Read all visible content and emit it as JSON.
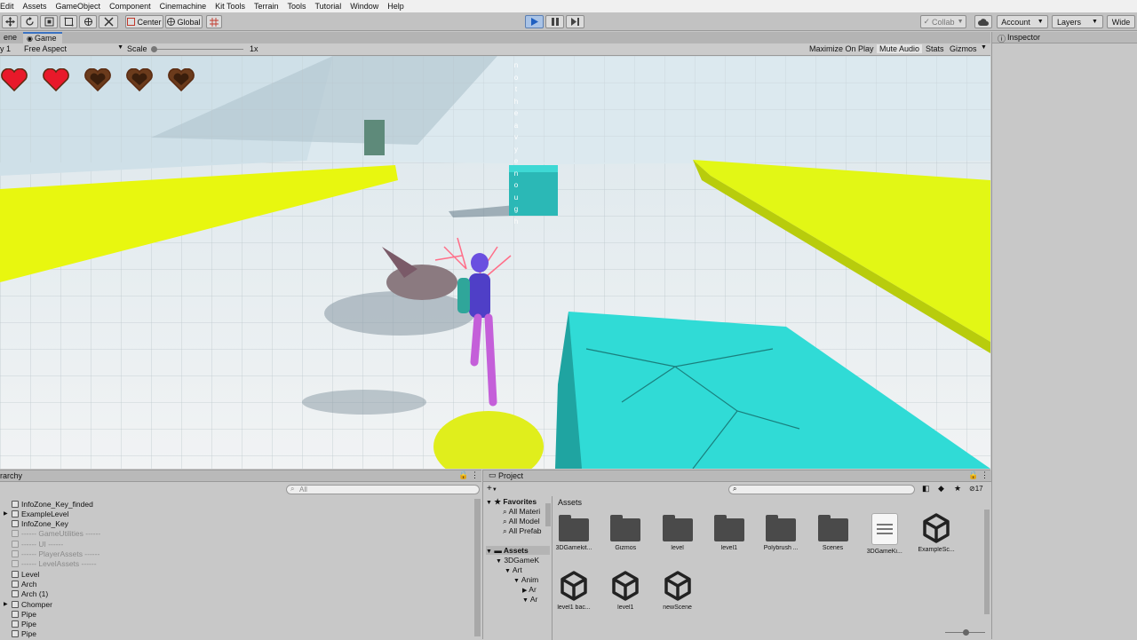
{
  "menu": [
    "Edit",
    "Assets",
    "GameObject",
    "Component",
    "Cinemachine",
    "Kit Tools",
    "Terrain",
    "Tools",
    "Tutorial",
    "Window",
    "Help"
  ],
  "toolbar": {
    "pivot": "Center",
    "space": "Global",
    "collab": "Collab",
    "account": "Account",
    "layers": "Layers",
    "layout": "Wide"
  },
  "tabs": {
    "scene": "ene",
    "game": "Game",
    "inspector": "Inspector",
    "hierarchy": "rarchy",
    "project": "Project"
  },
  "gamebar": {
    "display": "y 1",
    "aspect": "Free Aspect",
    "scale_label": "Scale",
    "scale_value": "1x",
    "maximize": "Maximize On Play",
    "mute": "Mute Audio",
    "stats": "Stats",
    "gizmos": "Gizmos"
  },
  "game": {
    "hearts": [
      {
        "state": "full",
        "color": "#e8192a"
      },
      {
        "state": "full",
        "color": "#e8192a"
      },
      {
        "state": "empty",
        "color": "#6b3b1c"
      },
      {
        "state": "empty",
        "color": "#6b3b1c"
      },
      {
        "state": "empty",
        "color": "#6b3b1c"
      }
    ],
    "vertical_text": [
      "n",
      "o",
      "t",
      "h",
      "e",
      "a",
      "v",
      "y",
      "e",
      "n",
      "o",
      "u",
      "g",
      "h"
    ],
    "colors": {
      "platform_yellow": "#e7f70f",
      "block_cyan": "#2fd9d4",
      "floor": "#e4e9eb",
      "wall": "#c3d6e0"
    }
  },
  "hierarchy": {
    "search_placeholder": "All",
    "items": [
      {
        "label": "InfoZone_Key_finded",
        "type": "normal",
        "expandable": false
      },
      {
        "label": "ExampleLevel",
        "type": "normal",
        "expandable": true
      },
      {
        "label": "InfoZone_Key",
        "type": "normal",
        "expandable": false
      },
      {
        "label": "------ GameUtilities ------",
        "type": "faded",
        "expandable": false
      },
      {
        "label": "------ UI ------",
        "type": "faded",
        "expandable": false
      },
      {
        "label": "------ PlayerAssets ------",
        "type": "faded",
        "expandable": false
      },
      {
        "label": "------ LevelAssets ------",
        "type": "faded",
        "expandable": false
      },
      {
        "label": "Level",
        "type": "normal",
        "expandable": false
      },
      {
        "label": "Arch",
        "type": "normal",
        "expandable": false
      },
      {
        "label": "Arch (1)",
        "type": "normal",
        "expandable": false
      },
      {
        "label": "Chomper",
        "type": "normal",
        "expandable": true
      },
      {
        "label": "Pipe",
        "type": "normal",
        "expandable": false
      },
      {
        "label": "Pipe",
        "type": "normal",
        "expandable": false
      },
      {
        "label": "Pipe",
        "type": "normal",
        "expandable": false
      }
    ]
  },
  "project": {
    "add_label": "+",
    "hidden_count": "17",
    "favorites_label": "Favorites",
    "favorites": [
      "All Materi",
      "All Model",
      "All Prefab"
    ],
    "tree_assets": "Assets",
    "tree": [
      "3DGameK",
      "Art",
      "Anim",
      "Ar",
      "Ar"
    ],
    "breadcrumb": "Assets",
    "assets": [
      {
        "label": "3DGamekit...",
        "kind": "folder"
      },
      {
        "label": "Gizmos",
        "kind": "folder"
      },
      {
        "label": "level",
        "kind": "folder"
      },
      {
        "label": "level1",
        "kind": "folder"
      },
      {
        "label": "Polybrush ...",
        "kind": "folder"
      },
      {
        "label": "Scenes",
        "kind": "folder"
      },
      {
        "label": "3DGameKi...",
        "kind": "document"
      },
      {
        "label": "ExampleSc...",
        "kind": "unity-scene"
      },
      {
        "label": "level1 bac...",
        "kind": "unity-scene"
      },
      {
        "label": "level1",
        "kind": "unity-scene"
      },
      {
        "label": "newScene",
        "kind": "unity-scene"
      }
    ]
  }
}
